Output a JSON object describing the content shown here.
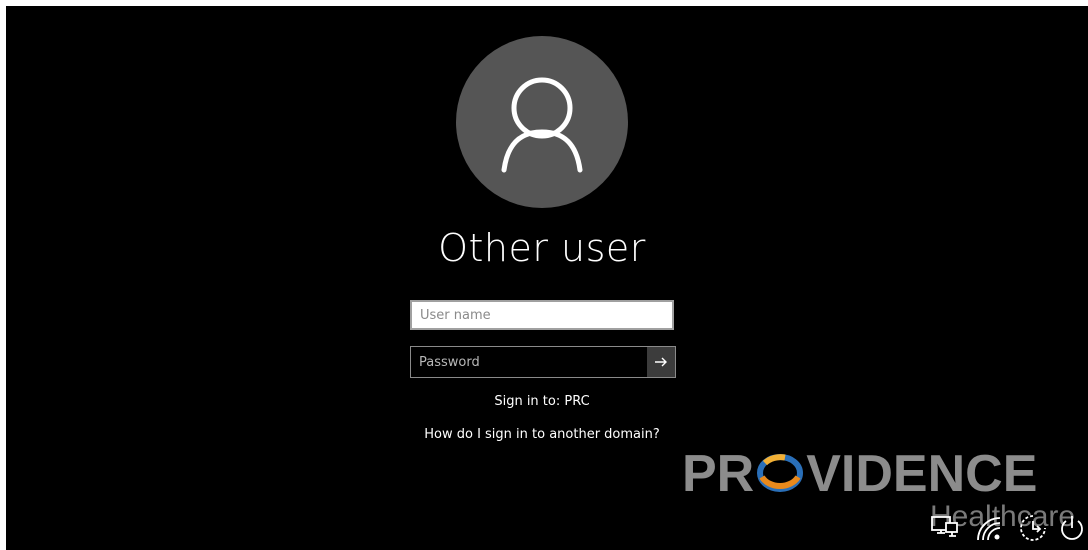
{
  "user": {
    "display_name": "Other user",
    "avatar_icon": "person-icon"
  },
  "form": {
    "username_placeholder": "User name",
    "username_value": "",
    "password_placeholder": "Password",
    "password_value": "",
    "submit_icon": "arrow-right-icon"
  },
  "sign_in_to": "Sign in to: PRC",
  "domain_link": "How do I sign in to another domain?",
  "logo": {
    "word_left": "PR",
    "word_right": "VIDENCE",
    "subtitle": "Healthcare"
  },
  "tray": {
    "icons": [
      "network-icon",
      "wifi-icon",
      "ease-of-access-icon",
      "power-icon"
    ]
  },
  "colors": {
    "background": "#000000",
    "avatar_circle": "#555555",
    "logo_gray": "#8c8c8c",
    "logo_ring_orange": "#e8891c",
    "logo_ring_blue": "#2a6fb8"
  }
}
